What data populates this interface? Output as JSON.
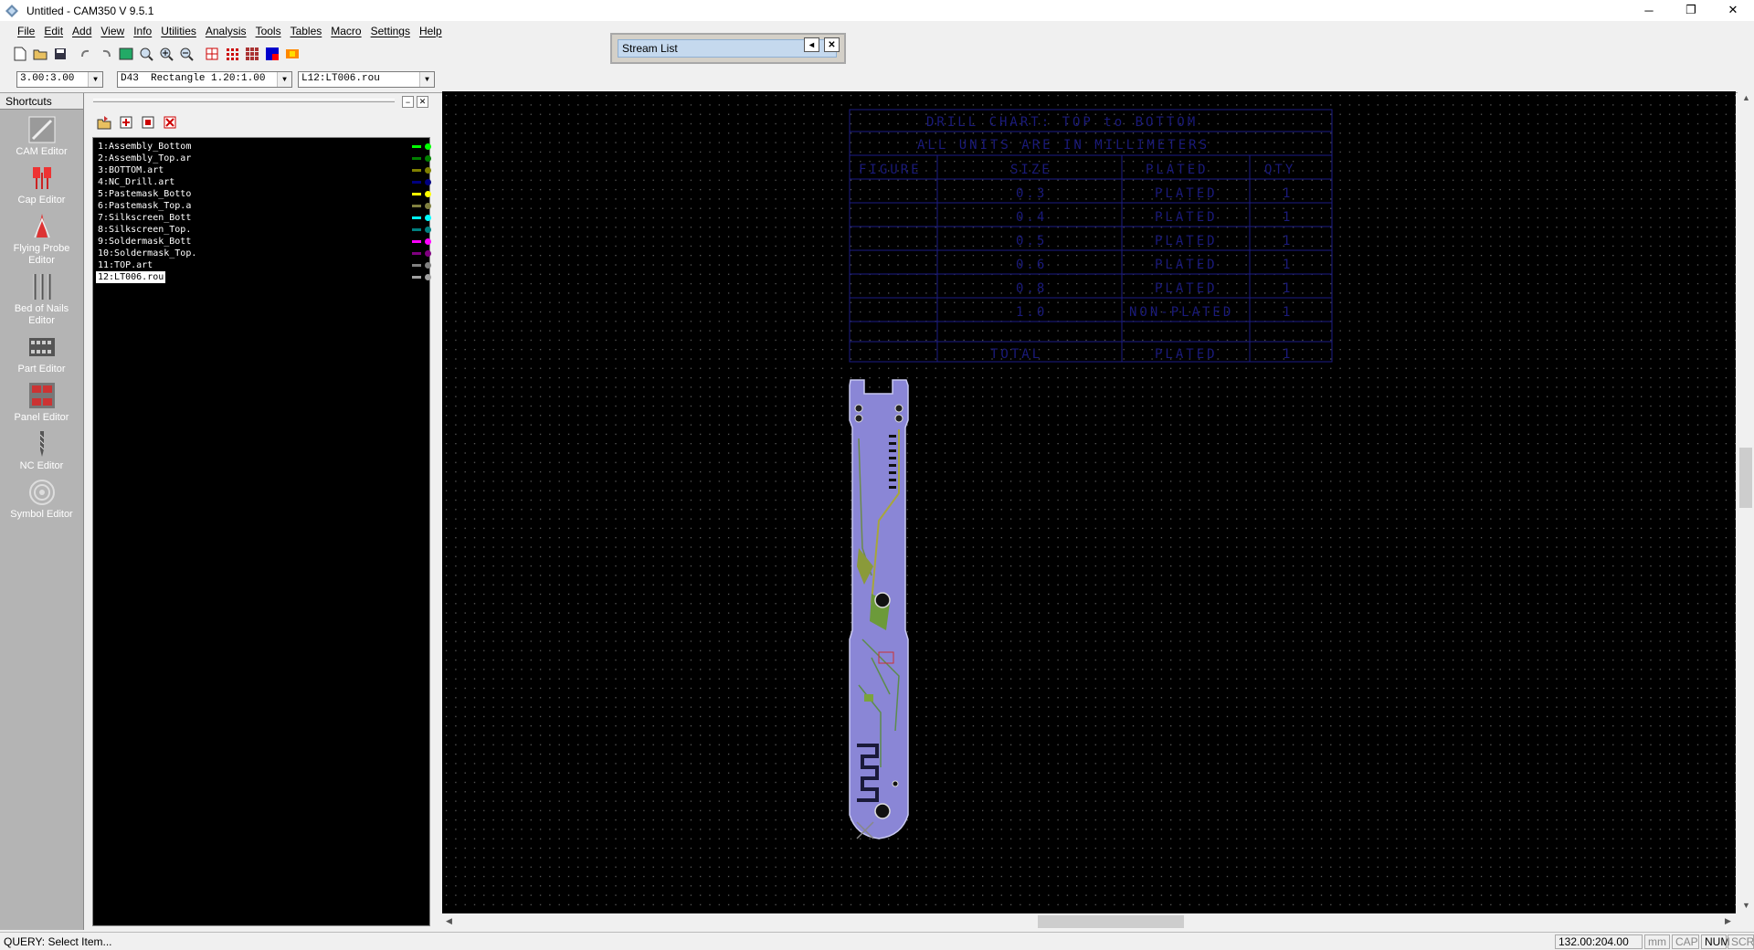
{
  "window": {
    "title": "Untitled - CAM350 V 9.5.1",
    "controls": [
      "─",
      "❐",
      "✕"
    ]
  },
  "menu": [
    "File",
    "Edit",
    "Add",
    "View",
    "Info",
    "Utilities",
    "Analysis",
    "Tools",
    "Tables",
    "Macro",
    "Settings",
    "Help"
  ],
  "toolbar": {
    "icons": [
      "new-icon",
      "open-icon",
      "save-icon",
      "undo-icon",
      "redo-icon",
      "redraw-icon",
      "zoom-window-icon",
      "zoom-in-icon",
      "zoom-out-icon",
      "layer-icon",
      "grid-icon",
      "grid-alt-icon",
      "color-icon",
      "settings-icon"
    ]
  },
  "combos": {
    "grid": "3.00:3.00",
    "dcode": "D43  Rectangle 1.20:1.00",
    "layer": "L12:LT006.rou"
  },
  "stream_list": {
    "title": "Stream List"
  },
  "shortcuts": {
    "header": "Shortcuts",
    "items": [
      {
        "label": "CAM Editor"
      },
      {
        "label": "Cap Editor"
      },
      {
        "label": "Flying Probe Editor"
      },
      {
        "label": "Bed of Nails Editor"
      },
      {
        "label": "Part Editor"
      },
      {
        "label": "Panel Editor"
      },
      {
        "label": "NC Editor"
      },
      {
        "label": "Symbol Editor"
      }
    ]
  },
  "layers": [
    {
      "name": "1:Assembly_Bottom",
      "color": "#00ff00",
      "visible": true
    },
    {
      "name": "2:Assembly_Top.ar",
      "color": "#008000",
      "visible": true
    },
    {
      "name": "3:BOTTOM.art",
      "color": "#808000",
      "visible": true
    },
    {
      "name": "4:NC_Drill.art",
      "color": "#000080",
      "visible": true
    },
    {
      "name": "5:Pastemask_Botto",
      "color": "#ffff00",
      "visible": true
    },
    {
      "name": "6:Pastemask_Top.a",
      "color": "#808040",
      "visible": true
    },
    {
      "name": "7:Silkscreen_Bott",
      "color": "#00ffff",
      "visible": true
    },
    {
      "name": "8:Silkscreen_Top.",
      "color": "#008080",
      "visible": true
    },
    {
      "name": "9:Soldermask_Bott",
      "color": "#ff00ff",
      "visible": true
    },
    {
      "name": "10:Soldermask_Top.",
      "color": "#800080",
      "visible": true
    },
    {
      "name": "11:TOP.art",
      "color": "#808080",
      "visible": true
    },
    {
      "name": "12:LT006.rou",
      "color": "#a0a0a0",
      "visible": true,
      "selected": true
    }
  ],
  "drill_table": {
    "title_line1": "DRILL CHART: TOP to BOTTOM",
    "title_line2": "ALL UNITS ARE IN MILLIMETERS",
    "headers": [
      "FIGURE",
      "SIZE",
      "PLATED",
      "QTY"
    ],
    "rows": [
      [
        "",
        "0.3",
        "PLATED",
        "1"
      ],
      [
        "",
        "0.4",
        "PLATED",
        "1"
      ],
      [
        "",
        "0.5",
        "PLATED",
        "1"
      ],
      [
        "",
        "0.6",
        "PLATED",
        "1"
      ],
      [
        "",
        "0.8",
        "PLATED",
        "1"
      ],
      [
        "",
        "1.0",
        "NON-PLATED",
        "1"
      ],
      [
        "",
        "TOTAL",
        "PLATED",
        "1"
      ]
    ]
  },
  "status": {
    "message": "QUERY: Select Item...",
    "coords": "132.00:204.00",
    "unit": "mm",
    "cap": "CAP",
    "num": "NUM",
    "scrl": "SCRL"
  },
  "colors": {
    "board": "#8a86d6",
    "canvas": "#000000",
    "table": "#1a1a7a"
  }
}
